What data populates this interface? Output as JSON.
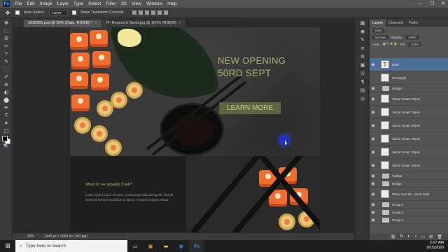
{
  "app": {
    "logo": "Ps"
  },
  "menubar": {
    "items": [
      "File",
      "Edit",
      "Image",
      "Layer",
      "Type",
      "Select",
      "Filter",
      "3D",
      "View",
      "Window",
      "Help"
    ],
    "win_controls": [
      "—",
      "❐",
      "✕"
    ]
  },
  "options": {
    "auto_select_label": "Auto-Select:",
    "layer_dropdown": "Layer",
    "transform_label": "Show Transform Controls"
  },
  "tabs": [
    {
      "label": "2528295.psd @ 50% (Date, RGB/8) *",
      "active": true
    },
    {
      "label": "IT- Research News.jpg @ 100% (RGB/8)",
      "active": false
    }
  ],
  "tab_close": "×",
  "tools": [
    "✥",
    "⬚",
    "ʘ",
    "✂",
    "⌖",
    "✎",
    "⬛",
    "✐",
    "⊕",
    "◐",
    "⬤",
    "✒",
    "T",
    "➤",
    "□",
    "✋",
    "🔍"
  ],
  "canvas": {
    "headline_1": "NEW OPENING",
    "headline_2": "50RD SEPT",
    "cta": "LEARN MORE",
    "lower_heading": "What do we actually Cook?",
    "lower_body": "Lorem ipsum dolor sit amet, consectetur adipisicing elit, sed do eiusmod tempor incididunt ut labore et dolore magna aliqua."
  },
  "status": {
    "zoom": "50%",
    "doc_size": "1440 px x 3000 px (300 ppi)"
  },
  "panel_strip_icons": [
    "▦",
    "◉",
    "✎",
    "≡",
    "⚙",
    "▣",
    "Ⓐ",
    "¶",
    "▤",
    "◎"
  ],
  "layers_panel": {
    "tabs": [
      "Layers",
      "Channels",
      "Paths"
    ],
    "kind_label": "Kind",
    "blend_mode": "Normal",
    "opacity_label": "Opacity:",
    "opacity_value": "100%",
    "lock_label": "Lock:",
    "fill_label": "Fill:",
    "fill_value": "100%",
    "layers": [
      {
        "name": "Date",
        "type": "text",
        "selected": true
      },
      {
        "name": "Rectangle",
        "type": "shape",
        "selected": false
      },
      {
        "name": "Design",
        "type": "group",
        "selected": false
      },
      {
        "name": "Vector Smart Object",
        "type": "smart",
        "selected": false
      },
      {
        "name": "Vector Smart Object",
        "type": "smart",
        "selected": false
      },
      {
        "name": "Vector Smart Object",
        "type": "smart",
        "selected": false
      },
      {
        "name": "Vector Smart Object",
        "type": "smart",
        "selected": false
      },
      {
        "name": "Vector Smart Object",
        "type": "smart",
        "selected": false
      },
      {
        "name": "Vector Smart Object",
        "type": "smart",
        "selected": false
      },
      {
        "name": "Toolbar",
        "type": "group",
        "selected": false
      },
      {
        "name": "Design",
        "type": "group",
        "selected": false
      },
      {
        "name": "Place Your De...ick to Edit)",
        "type": "smart",
        "selected": false
      },
      {
        "name": "Group 2",
        "type": "group",
        "selected": false
      },
      {
        "name": "Group 3",
        "type": "group",
        "selected": false
      },
      {
        "name": "Group 4",
        "type": "group",
        "selected": false
      }
    ],
    "footer_icons": [
      "⛓",
      "fx",
      "◐",
      "◑",
      "▭",
      "⊞",
      "🗑"
    ]
  },
  "taskbar": {
    "search_placeholder": "Type here to search",
    "time": "2:07 AM",
    "date": "9/15/2020"
  },
  "colors": {
    "accent_text": "#a8ad6a",
    "cta_bg": "#5f6541",
    "layer_selected": "#4d6f96"
  }
}
